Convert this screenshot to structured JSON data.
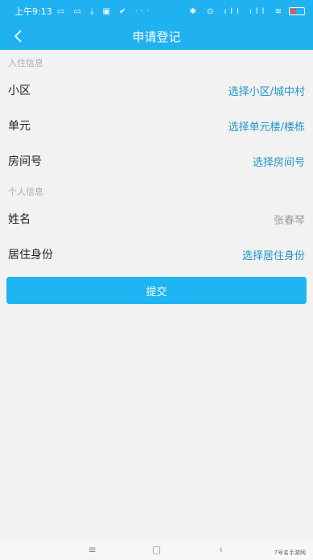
{
  "status_bar": {
    "time": "上午9:13",
    "left_icons": "▭ ▭ ⤓ ▣ ✔ ···",
    "right_icons": "✱ ⊙ ıll ıll ≋"
  },
  "header": {
    "title": "申请登记",
    "back_icon": "chevron-left-icon",
    "color": "#1fb1f0"
  },
  "sections": {
    "residence": {
      "title": "入住信息",
      "rows": [
        {
          "label": "小区",
          "value": "选择小区/城中村"
        },
        {
          "label": "单元",
          "value": "选择单元楼/楼栋"
        },
        {
          "label": "房间号",
          "value": "选择房间号"
        }
      ]
    },
    "personal": {
      "title": "个人信息",
      "rows": [
        {
          "label": "姓名",
          "value": "张春琴"
        },
        {
          "label": "居住身份",
          "value": "选择居住身份"
        }
      ]
    }
  },
  "submit_label": "提交",
  "nav": {
    "menu": "≡",
    "home": "▢",
    "back": "‹"
  },
  "watermark": "7号名手游网"
}
